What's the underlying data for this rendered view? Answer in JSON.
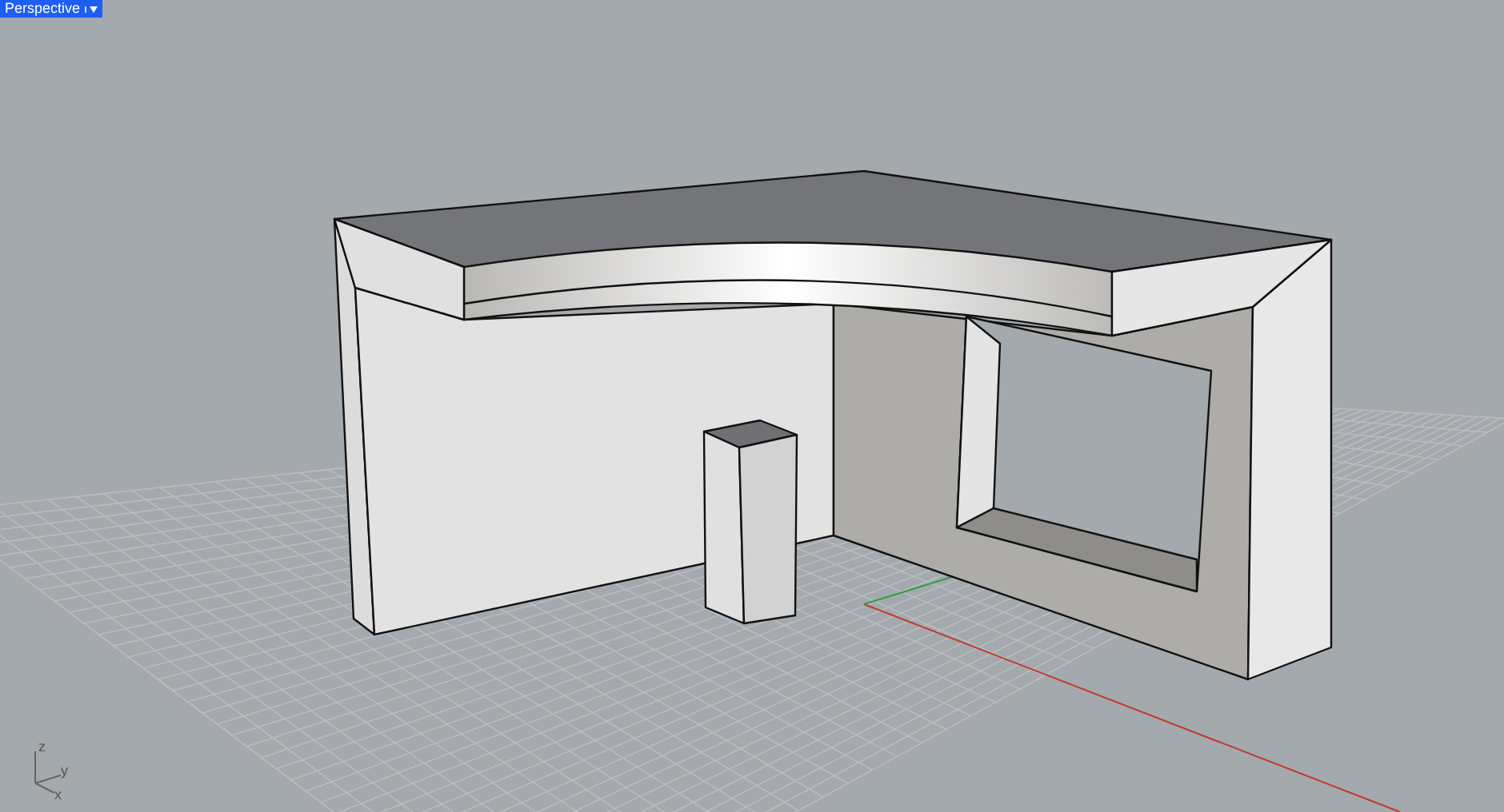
{
  "viewport_tab": {
    "label": "Perspective"
  },
  "axis_widget": {
    "labels": [
      "z",
      "y",
      "x"
    ]
  }
}
